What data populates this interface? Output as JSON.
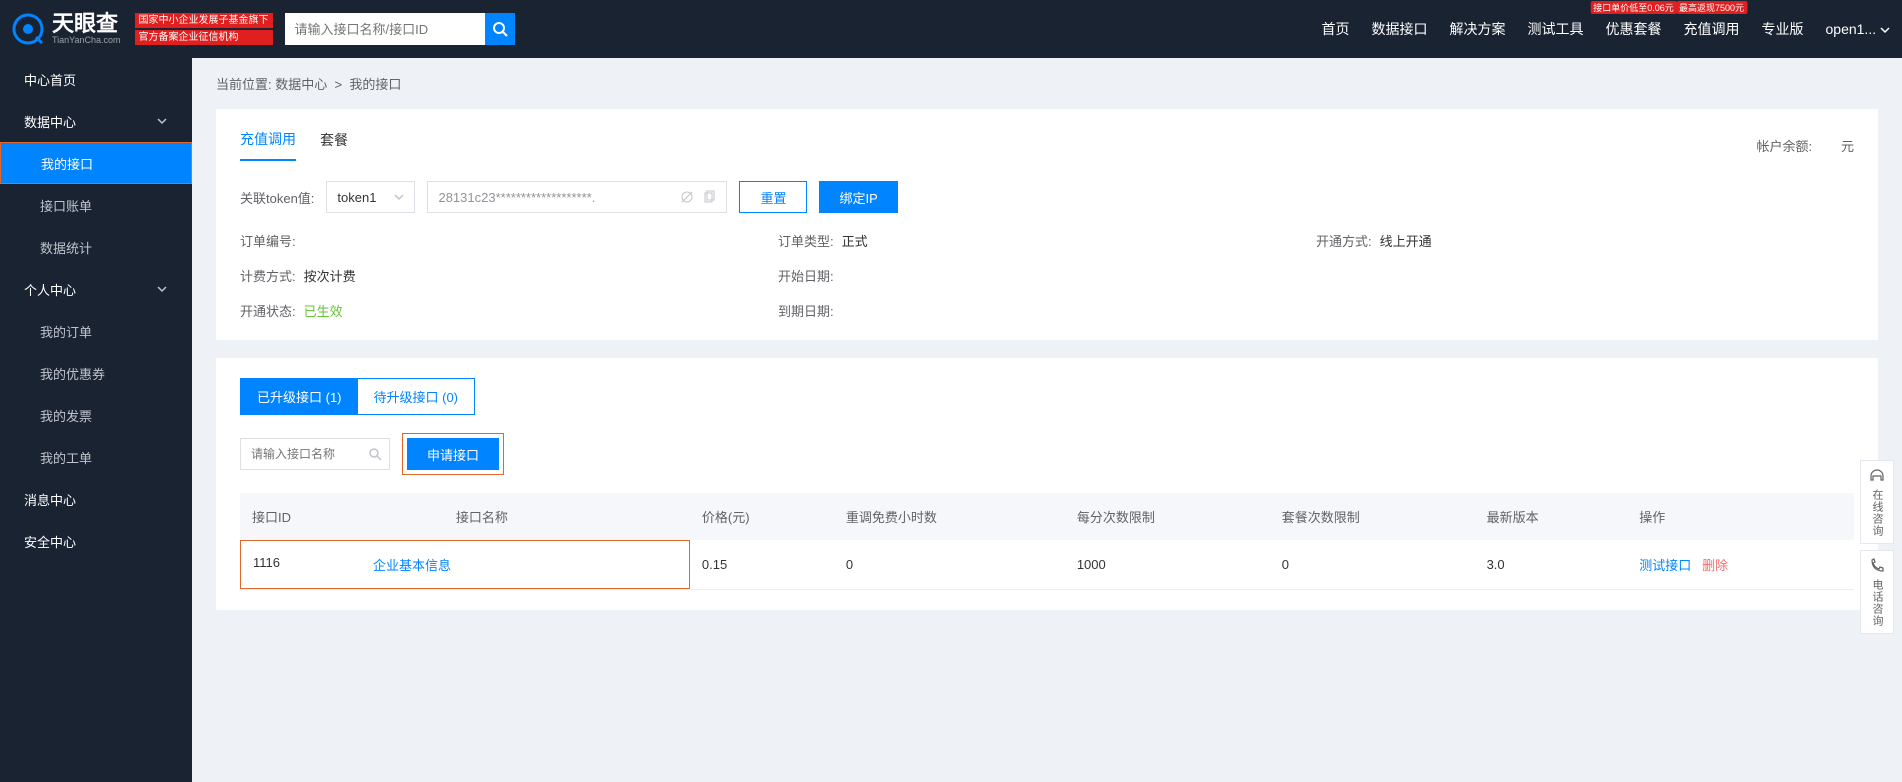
{
  "header": {
    "logo_text": "天眼查",
    "logo_sub": "TianYanCha.com",
    "badge1": "国家中小企业发展子基金旗下",
    "badge2": "官方备案企业征信机构",
    "search_placeholder": "请输入接口名称/接口ID",
    "nav": [
      "首页",
      "数据接口",
      "解决方案",
      "测试工具",
      "优惠套餐",
      "充值调用",
      "专业版",
      "open1..."
    ],
    "nav_badge_discount": "接口单价低至0.06元",
    "nav_badge_cashback": "最高返现7500元"
  },
  "sidebar": {
    "items": [
      {
        "label": "中心首页"
      },
      {
        "label": "数据中心",
        "expandable": true
      },
      {
        "label": "我的接口",
        "active": true,
        "highlighted": true
      },
      {
        "label": "接口账单"
      },
      {
        "label": "数据统计"
      },
      {
        "label": "个人中心",
        "expandable": true
      },
      {
        "label": "我的订单"
      },
      {
        "label": "我的优惠券"
      },
      {
        "label": "我的发票"
      },
      {
        "label": "我的工单"
      },
      {
        "label": "消息中心"
      },
      {
        "label": "安全中心"
      }
    ]
  },
  "breadcrumb": {
    "prefix": "当前位置:",
    "parts": [
      "数据中心",
      "我的接口"
    ]
  },
  "main": {
    "tabs": [
      "充值调用",
      "套餐"
    ],
    "balance_label": "帐户余额:",
    "balance_unit": "元",
    "token_label": "关联token值:",
    "token_select": "token1",
    "token_value": "28131c23*******************.",
    "reset_btn": "重置",
    "bind_btn": "绑定IP",
    "info": {
      "order_no_label": "订单编号:",
      "order_no": "",
      "order_type_label": "订单类型:",
      "order_type": "正式",
      "open_method_label": "开通方式:",
      "open_method": "线上开通",
      "billing_label": "计费方式:",
      "billing": "按次计费",
      "start_label": "开始日期:",
      "start": "",
      "status_label": "开通状态:",
      "status": "已生效",
      "expire_label": "到期日期:",
      "expire": ""
    },
    "sub_tabs": {
      "upgraded": "已升级接口 (1)",
      "pending": "待升级接口 (0)"
    },
    "filter_placeholder": "请输入接口名称",
    "apply_btn": "申请接口",
    "table": {
      "headers": [
        "接口ID",
        "接口名称",
        "价格(元)",
        "重调免费小时数",
        "每分次数限制",
        "套餐次数限制",
        "最新版本",
        "操作"
      ],
      "row": {
        "id": "1116",
        "name": "企业基本信息",
        "price": "0.15",
        "free_hours": "0",
        "minute_limit": "1000",
        "package_limit": "0",
        "version": "3.0",
        "action_test": "测试接口",
        "action_delete": "删除"
      }
    }
  },
  "float": {
    "consult": "在线咨询",
    "phone": "电话咨询"
  }
}
